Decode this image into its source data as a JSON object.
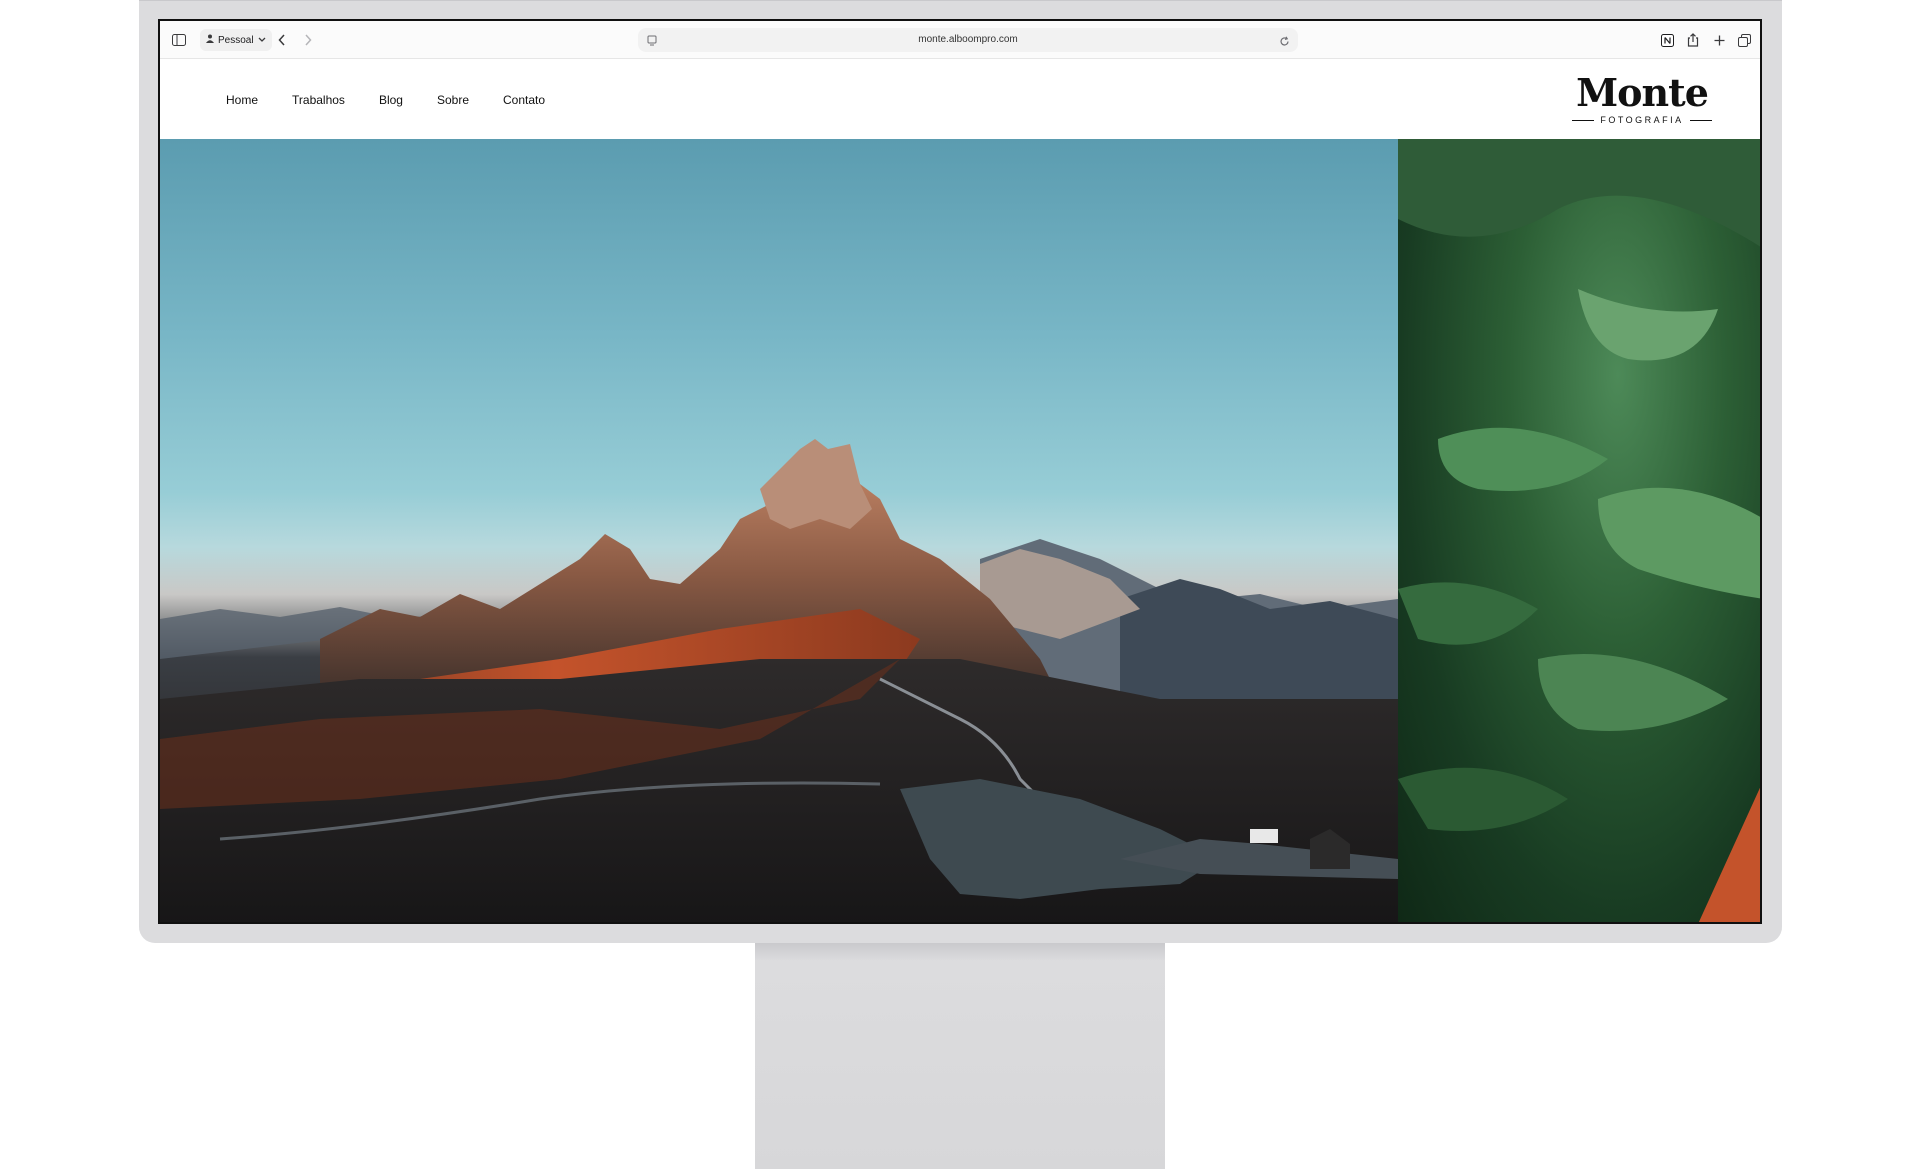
{
  "browser": {
    "profile_label": "Pessoal",
    "url": "monte.alboompro.com",
    "icons": {
      "sidebar": "sidebar-icon",
      "profile": "person-icon",
      "back": "chevron-left-icon",
      "forward": "chevron-right-icon",
      "page_settings": "page-settings-icon",
      "reload": "reload-icon",
      "extension": "notion-extension-icon",
      "share": "share-icon",
      "new_tab": "plus-icon",
      "tabs": "tab-overview-icon"
    }
  },
  "site": {
    "nav": [
      {
        "label": "Home"
      },
      {
        "label": "Trabalhos"
      },
      {
        "label": "Blog"
      },
      {
        "label": "Sobre"
      },
      {
        "label": "Contato"
      }
    ],
    "logo": {
      "name": "Monte",
      "subtitle": "FOTOGRAFIA"
    }
  },
  "colors": {
    "monitor_frame": "#dcdcde",
    "text": "#111111",
    "sky": "#78b6c6",
    "mountain_glow": "#c4532b",
    "forest": "#2c5f35"
  }
}
